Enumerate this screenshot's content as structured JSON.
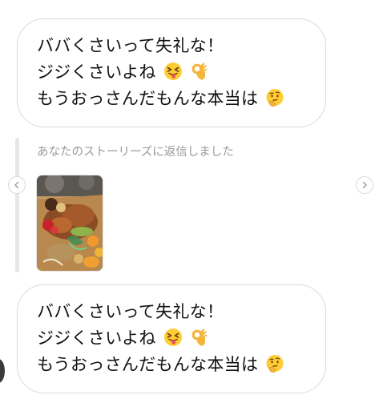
{
  "messages": [
    {
      "lines": [
        {
          "text": "ババくさいって失礼な！",
          "emoji": []
        },
        {
          "text": "ジジくさいよね",
          "emoji": [
            "squinting-tongue-face-icon",
            "ok-hand-icon"
          ]
        },
        {
          "text": "もうおっさんだもんな本当は",
          "emoji": [
            "thinking-face-icon"
          ]
        }
      ]
    },
    {
      "lines": [
        {
          "text": "ババくさいって失礼な！",
          "emoji": []
        },
        {
          "text": "ジジくさいよね",
          "emoji": [
            "squinting-tongue-face-icon",
            "ok-hand-icon"
          ]
        },
        {
          "text": "もうおっさんだもんな本当は",
          "emoji": [
            "thinking-face-icon"
          ]
        }
      ]
    }
  ],
  "story_reply": {
    "caption": "あなたのストーリーズに返信しました",
    "thumbnail": "story-thumbnail-image"
  },
  "colors": {
    "bubble_border": "#dadada",
    "caption_text": "#9a9a9a",
    "reply_bar": "#e7e7e7"
  }
}
